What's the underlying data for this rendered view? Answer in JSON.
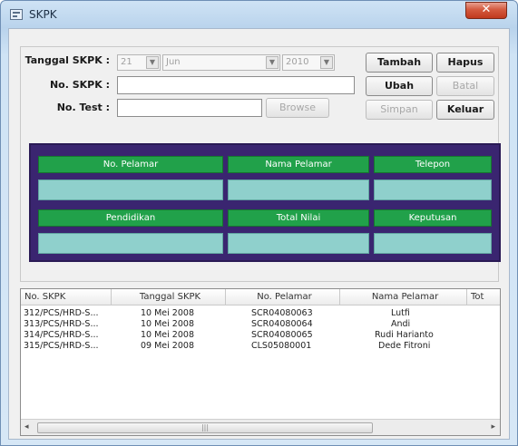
{
  "window": {
    "title": "SKPK",
    "close_label": "✕"
  },
  "form": {
    "tanggal_label": "Tanggal SKPK :",
    "day": "21",
    "month": "Jun",
    "year": "2010",
    "no_skpk_label": "No. SKPK :",
    "no_skpk_value": "",
    "no_test_label": "No. Test :",
    "no_test_value": "",
    "browse_label": "Browse"
  },
  "buttons": {
    "tambah": "Tambah",
    "hapus": "Hapus",
    "ubah": "Ubah",
    "batal": "Batal",
    "simpan": "Simpan",
    "keluar": "Keluar"
  },
  "panel": {
    "headers_top": [
      "No. Pelamar",
      "Nama Pelamar",
      "Telepon"
    ],
    "headers_bottom": [
      "Pendidikan",
      "Total Nilai",
      "Keputusan"
    ]
  },
  "table": {
    "columns": [
      "No. SKPK",
      "Tanggal SKPK",
      "No. Pelamar",
      "Nama Pelamar",
      "Tot"
    ],
    "rows": [
      [
        "312/PCS/HRD-S...",
        "10 Mei 2008",
        "SCR04080063",
        "Lutfi"
      ],
      [
        "313/PCS/HRD-S...",
        "10 Mei 2008",
        "SCR04080064",
        "Andi"
      ],
      [
        "314/PCS/HRD-S...",
        "10 Mei 2008",
        "SCR04080065",
        "Rudi Harianto"
      ],
      [
        "315/PCS/HRD-S...",
        "09 Mei 2008",
        "CLS05080001",
        "Dede Fitroni"
      ]
    ]
  },
  "scrollbar": {
    "left_arrow": "◂",
    "grip": "|||",
    "right_arrow": "▸"
  },
  "colors": {
    "panel": "#3a2570",
    "header": "#21a14a",
    "field": "#8fd0cc"
  }
}
